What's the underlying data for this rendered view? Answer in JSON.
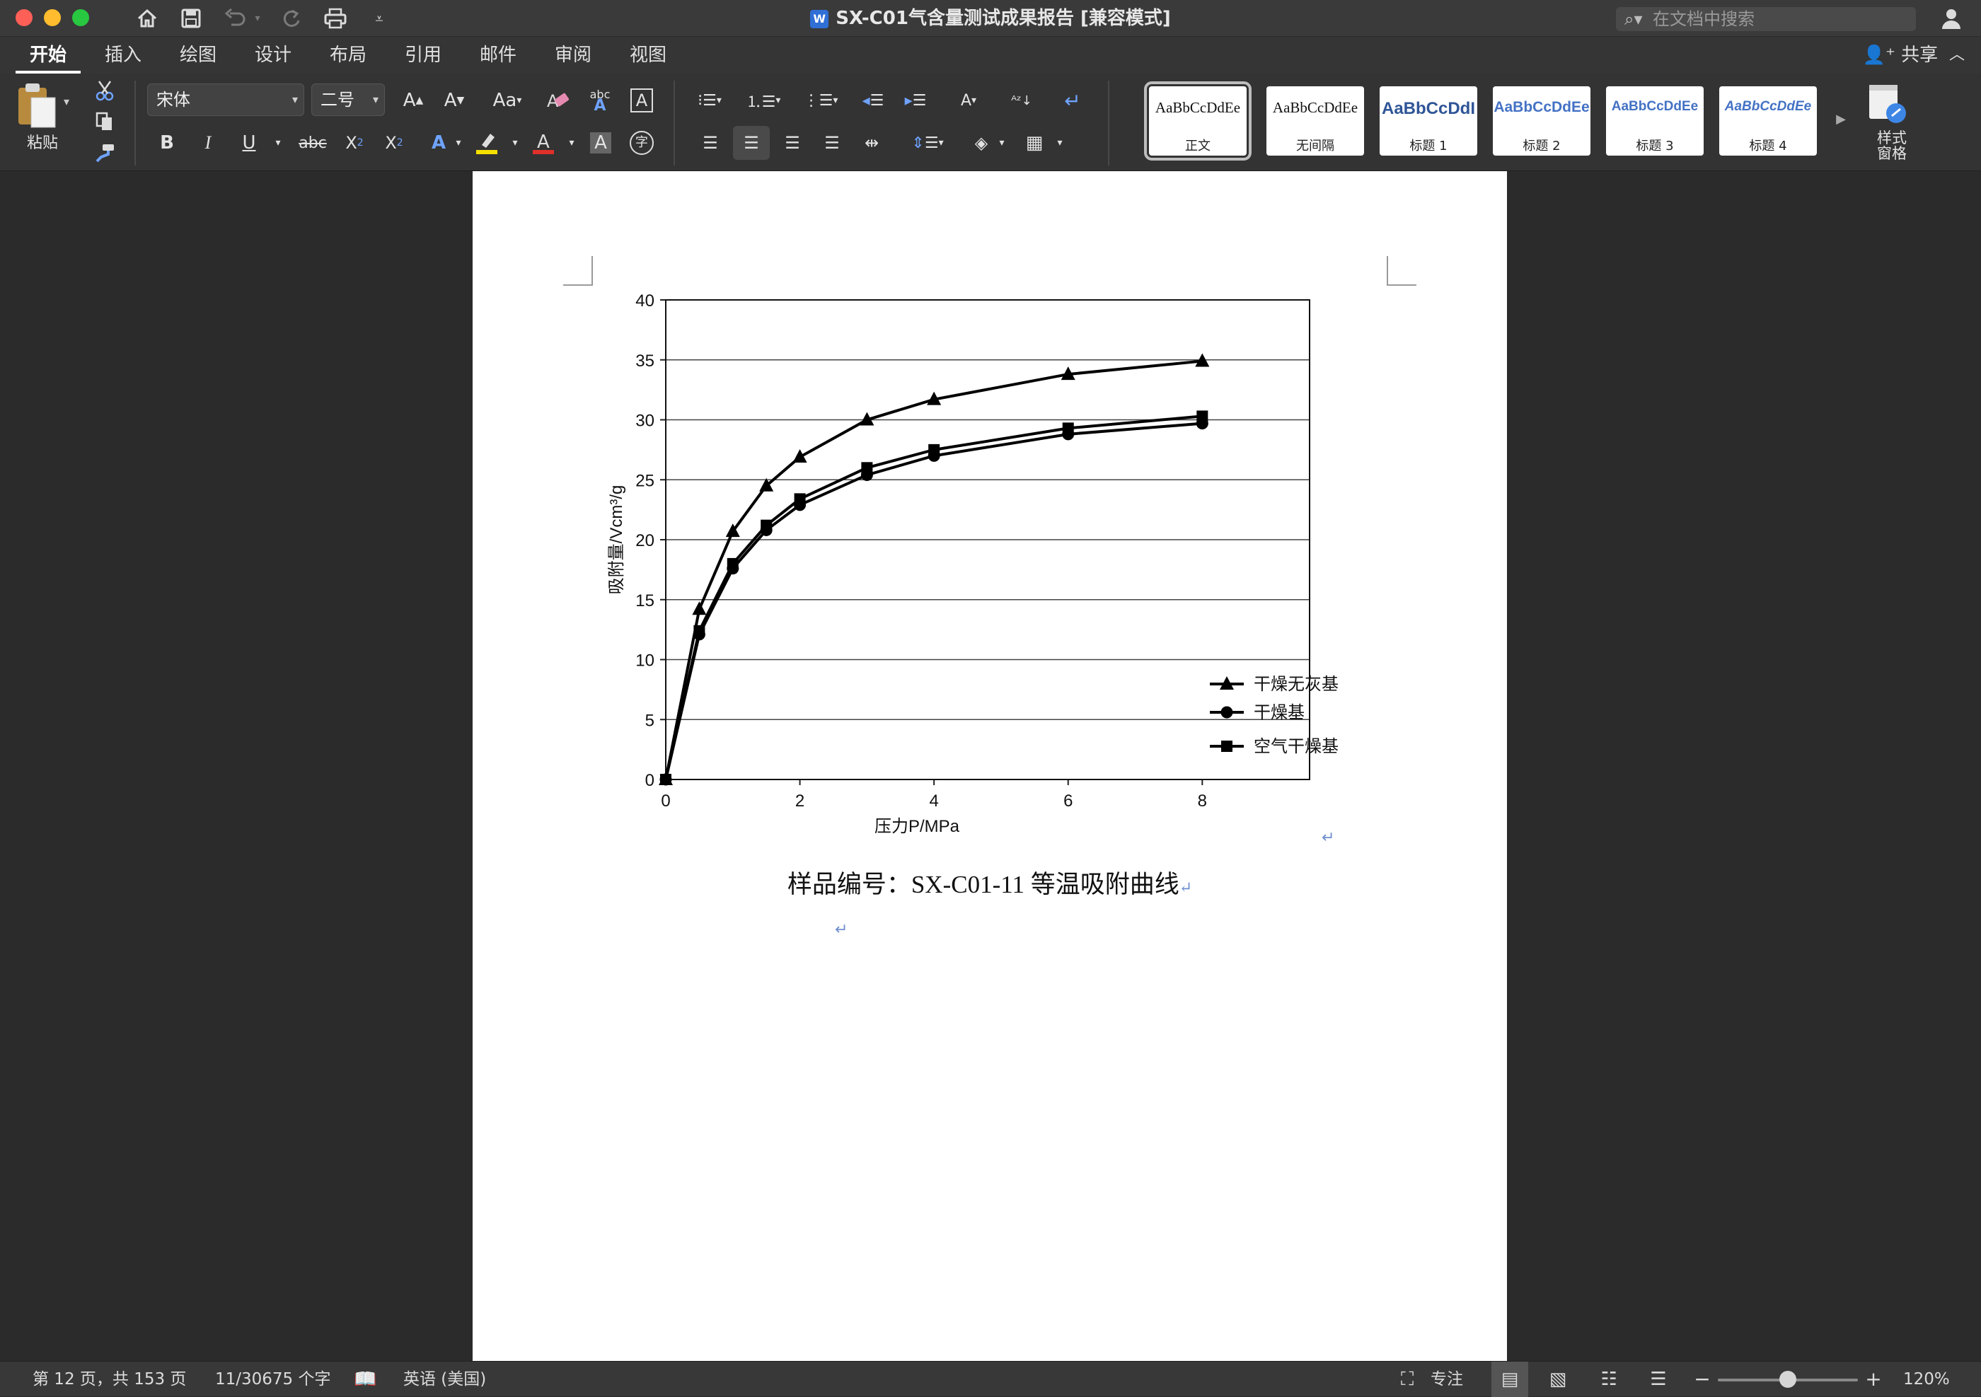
{
  "window": {
    "title": "SX-C01气含量测试成果报告 [兼容模式]",
    "app_icon": "word-document-icon",
    "search_placeholder": "在文档中搜索"
  },
  "quick_access": [
    "home-icon",
    "save-icon",
    "undo-icon",
    "redo-icon",
    "print-icon",
    "customize-chevron-icon"
  ],
  "tabs": [
    {
      "label": "开始",
      "active": true
    },
    {
      "label": "插入"
    },
    {
      "label": "绘图"
    },
    {
      "label": "设计"
    },
    {
      "label": "布局"
    },
    {
      "label": "引用"
    },
    {
      "label": "邮件"
    },
    {
      "label": "审阅"
    },
    {
      "label": "视图"
    }
  ],
  "share_label": "共享",
  "ribbon": {
    "paste_label": "粘贴",
    "font_name": "宋体",
    "font_size": "二号",
    "styles": [
      {
        "sample": "AaBbCcDdEe",
        "name": "正文",
        "color": "#111111"
      },
      {
        "sample": "AaBbCcDdEe",
        "name": "无间隔",
        "color": "#111111"
      },
      {
        "sample": "AaBbCcDdI",
        "name": "标题 1",
        "color": "#2f5597"
      },
      {
        "sample": "AaBbCcDdEe",
        "name": "标题 2",
        "color": "#4472c4"
      },
      {
        "sample": "AaBbCcDdEe",
        "name": "标题 3",
        "color": "#4472c4"
      },
      {
        "sample": "AaBbCcDdEe",
        "name": "标题 4",
        "color": "#4472c4"
      }
    ],
    "style_pane_label": "样式\n窗格"
  },
  "document": {
    "caption": "样品编号：SX-C01-11 等温吸附曲线",
    "para_mark": "↵"
  },
  "chart_data": {
    "type": "line",
    "title": "",
    "xlabel": "压力P/MPa",
    "ylabel": "吸附量/Vcm³/g",
    "xlim": [
      0,
      9.6
    ],
    "ylim": [
      0,
      40
    ],
    "xticks": [
      0,
      2,
      4,
      6,
      8
    ],
    "yticks": [
      0,
      5,
      10,
      15,
      20,
      25,
      30,
      35,
      40
    ],
    "grid": "horizontal",
    "legend_position": "lower-right",
    "series": [
      {
        "name": "干燥无灰基",
        "marker": "triangle",
        "x": [
          0,
          0.5,
          1,
          1.5,
          2,
          3,
          4,
          6,
          8
        ],
        "y": [
          0,
          14.2,
          20.7,
          24.5,
          26.9,
          30.0,
          31.7,
          33.8,
          34.9
        ]
      },
      {
        "name": "干燥基",
        "marker": "circle",
        "x": [
          0,
          0.5,
          1,
          1.5,
          2,
          3,
          4,
          6,
          8
        ],
        "y": [
          0,
          12.1,
          17.6,
          20.8,
          22.9,
          25.4,
          27.0,
          28.8,
          29.7
        ]
      },
      {
        "name": "空气干燥基",
        "marker": "square",
        "x": [
          0,
          0.5,
          1,
          1.5,
          2,
          3,
          4,
          6,
          8
        ],
        "y": [
          0,
          12.4,
          18.0,
          21.2,
          23.4,
          26.0,
          27.5,
          29.3,
          30.3
        ]
      }
    ]
  },
  "status": {
    "page": "第 12 页，共 153 页",
    "words": "11/30675 个字",
    "language": "英语 (美国)",
    "focus": "专注",
    "zoom": "120%",
    "zoom_level": 0.5
  }
}
